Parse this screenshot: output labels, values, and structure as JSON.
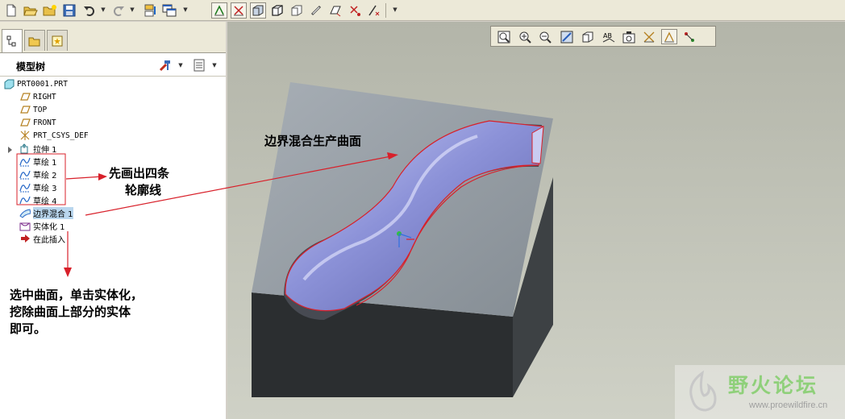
{
  "model_tree": {
    "title": "模型树",
    "items": [
      {
        "label": "PRT0001.PRT",
        "icon": "part-icon"
      },
      {
        "label": "RIGHT",
        "icon": "datum-plane-icon"
      },
      {
        "label": "TOP",
        "icon": "datum-plane-icon"
      },
      {
        "label": "FRONT",
        "icon": "datum-plane-icon"
      },
      {
        "label": "PRT_CSYS_DEF",
        "icon": "csys-icon"
      },
      {
        "label": "拉伸 1",
        "icon": "extrude-icon"
      },
      {
        "label": "草绘 1",
        "icon": "sketch-icon"
      },
      {
        "label": "草绘 2",
        "icon": "sketch-icon"
      },
      {
        "label": "草绘 3",
        "icon": "sketch-icon"
      },
      {
        "label": "草绘 4",
        "icon": "sketch-icon"
      },
      {
        "label": "边界混合 1",
        "icon": "boundary-blend-icon",
        "selected": true
      },
      {
        "label": "实体化 1",
        "icon": "solidify-icon"
      },
      {
        "label": "在此插入",
        "icon": "insert-here-icon"
      }
    ]
  },
  "annotations": {
    "sketch_note_line1": "先画出四条",
    "sketch_note_line2": "轮廓线",
    "surface_note": "边界混合生产曲面",
    "solidify_note_line1": "选中曲面，单击实体化，",
    "solidify_note_line2": "挖除曲面上部分的实体",
    "solidify_note_line3": "即可。"
  },
  "watermark": {
    "name": "野火论坛",
    "url": "www.proewildfire.cn"
  },
  "colors": {
    "annotation_red": "#d8202a",
    "surface_blue": "#8c92d8",
    "selection_blue": "#b9d6ee",
    "block_top": "#8f979e",
    "block_side": "#2f3234"
  }
}
